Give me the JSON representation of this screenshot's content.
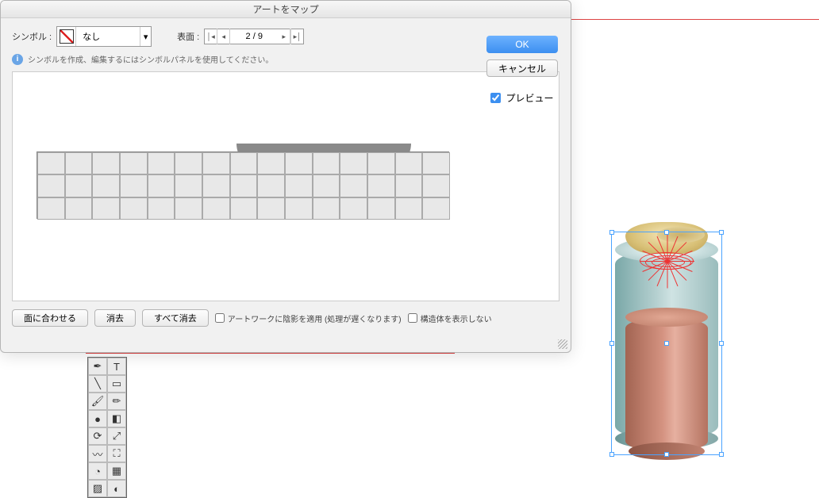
{
  "dialog": {
    "title": "アートをマップ",
    "symbol_label": "シンボル :",
    "symbol_value": "なし",
    "surface_label": "表面 :",
    "surface_value": "2 / 9",
    "info_text": "シンボルを作成、編集するにはシンボルパネルを使用してください。",
    "buttons": {
      "fit": "面に合わせる",
      "clear": "消去",
      "clear_all": "すべて消去"
    },
    "checkboxes": {
      "shade": "アートワークに陰影を適用 (処理が遅くなります)",
      "structure": "構造体を表示しない"
    },
    "ok": "OK",
    "cancel": "キャンセル",
    "preview": "プレビュー"
  },
  "tools": [
    "pen-tool",
    "type-tool",
    "line-tool",
    "rectangle-tool",
    "brush-tool",
    "pencil-tool",
    "blob-tool",
    "eraser-tool",
    "rotate-tool",
    "scale-tool",
    "width-tool",
    "free-transform-tool",
    "shape-builder-tool",
    "perspective-tool",
    "mesh-tool",
    "gradient-tool"
  ]
}
